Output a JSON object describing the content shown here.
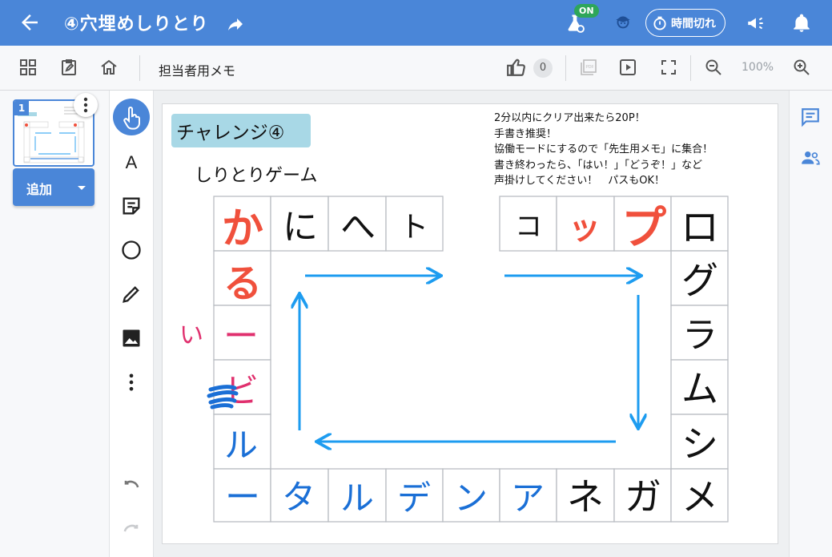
{
  "header": {
    "title": "④穴埋めしりとり",
    "on_badge": "ON",
    "timer_label": "時間切れ"
  },
  "toolbar": {
    "memo_label": "担当者用メモ",
    "like_count": "0",
    "zoom": "100%"
  },
  "sidebar": {
    "page_number": "1",
    "add_label": "追加"
  },
  "canvas": {
    "challenge": "チャレンジ④",
    "game_title": "しりとりゲーム",
    "notes": [
      "2分以内にクリア出来たら20P！",
      "手書き推奨！",
      "協働モードにするので「先生用メモ」に集合！",
      "書き終わったら、「はい！」「どうぞ！」など",
      "声掛けしてください！　パスもOK！"
    ],
    "top_left_row": [
      "か",
      "に",
      "へ",
      "ト"
    ],
    "top_right_row": [
      "コ",
      "ッ",
      "プ",
      "ロ"
    ],
    "right_column": [
      "グ",
      "ラ",
      "ム",
      "シ"
    ],
    "bottom_row": [
      "ー",
      "タ",
      "ル",
      "デ",
      "ン",
      "ア",
      "ネ",
      "ガ",
      "メ"
    ],
    "left_column": [
      "る",
      "ー",
      "ビ",
      "ル"
    ],
    "side_note": "い"
  },
  "colors": {
    "accent": "#4a86d8",
    "ink_red": "#f0503c",
    "ink_pink": "#e0306e",
    "ink_blue": "#1a6fd6",
    "arrow_blue": "#1d9cf0"
  }
}
